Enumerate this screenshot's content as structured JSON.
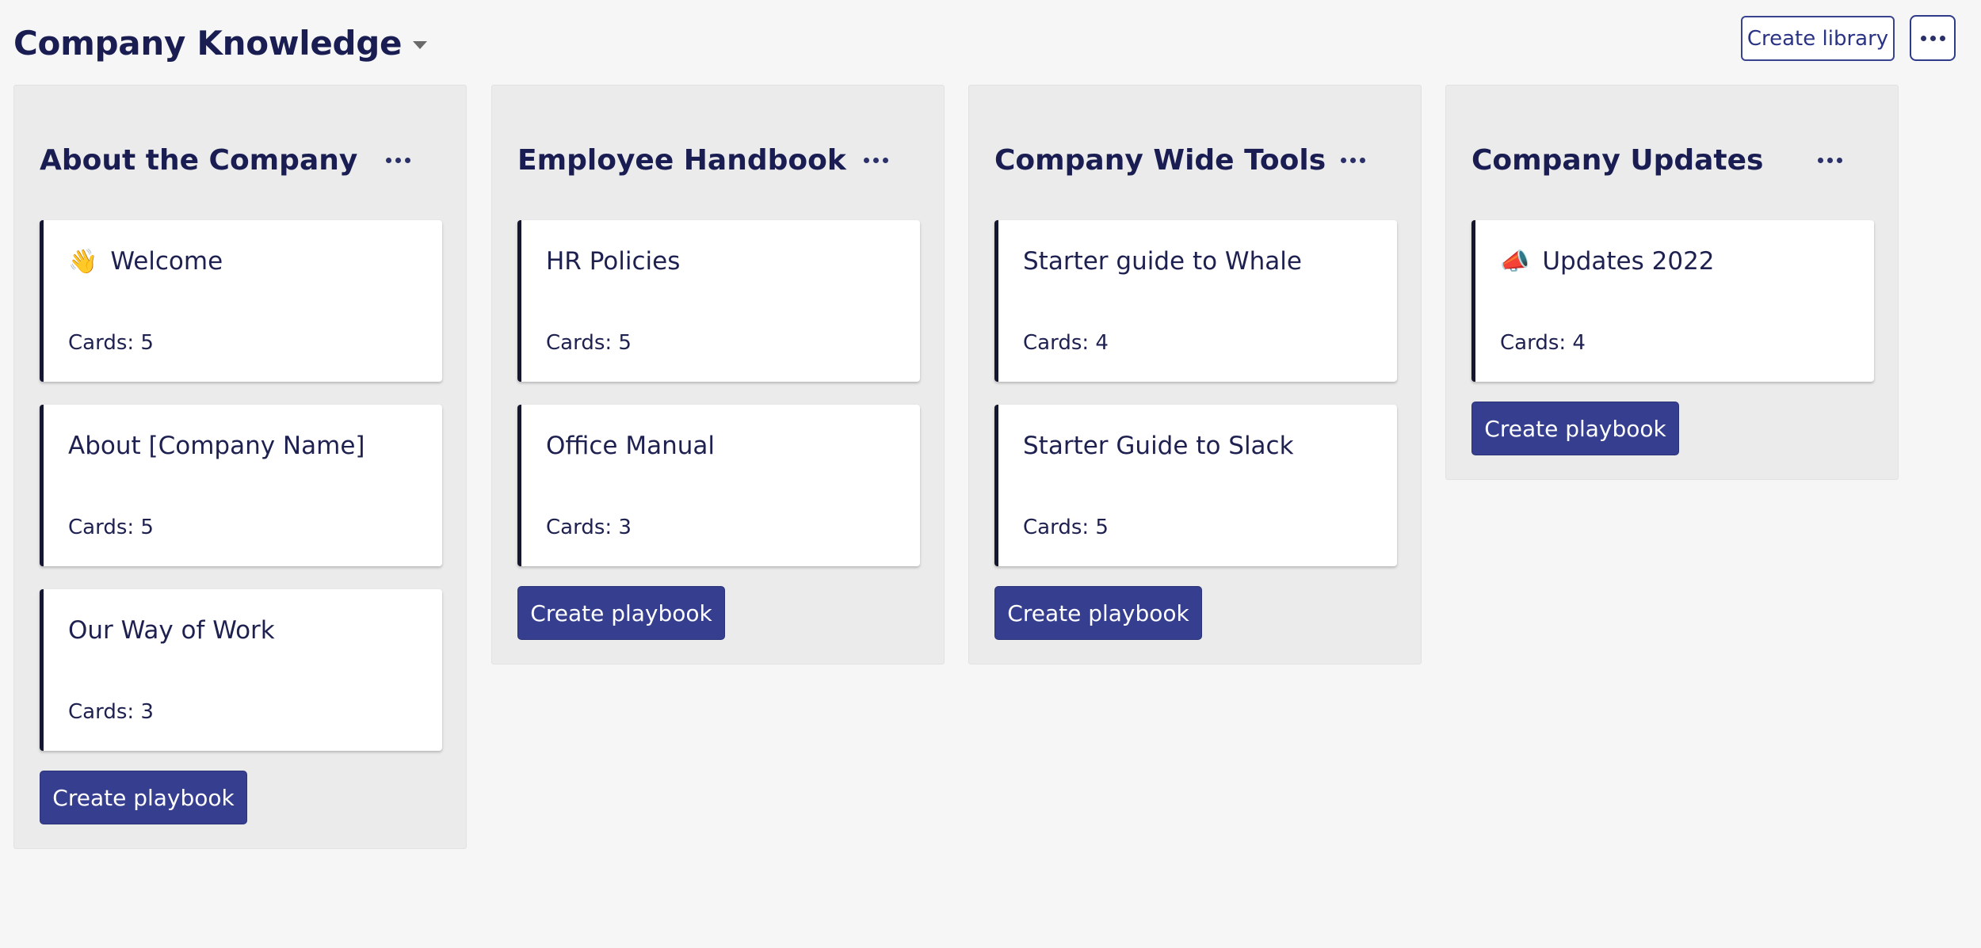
{
  "header": {
    "title": "Company Knowledge",
    "create_library_label": "Create library",
    "more_icon": "ellipsis-icon",
    "caret_icon": "caret-down-icon"
  },
  "columns": [
    {
      "title": "About the Company",
      "cards": [
        {
          "emoji": "👋",
          "title": "Welcome",
          "count": "Cards: 5"
        },
        {
          "emoji": "",
          "title": "About [Company Name]",
          "count": "Cards: 5"
        },
        {
          "emoji": "",
          "title": "Our Way of Work",
          "count": "Cards: 3"
        }
      ],
      "button_label": "Create playbook"
    },
    {
      "title": "Employee Handbook",
      "cards": [
        {
          "emoji": "",
          "title": "HR Policies",
          "count": "Cards: 5"
        },
        {
          "emoji": "",
          "title": "Office Manual",
          "count": "Cards: 3"
        }
      ],
      "button_label": "Create playbook"
    },
    {
      "title": "Company Wide Tools",
      "cards": [
        {
          "emoji": "",
          "title": "Starter guide to Whale",
          "count": "Cards: 4"
        },
        {
          "emoji": "",
          "title": "Starter Guide to Slack",
          "count": "Cards: 5"
        }
      ],
      "button_label": "Create playbook"
    },
    {
      "title": "Company Updates",
      "cards": [
        {
          "emoji": "📣",
          "title": "Updates 2022",
          "count": "Cards: 4"
        }
      ],
      "button_label": "Create playbook"
    }
  ],
  "colors": {
    "accent": "#363f8f",
    "text": "#1a1d52",
    "card_border": "#14172f",
    "column_bg": "#ebebeb",
    "page_bg": "#f6f6f6"
  }
}
